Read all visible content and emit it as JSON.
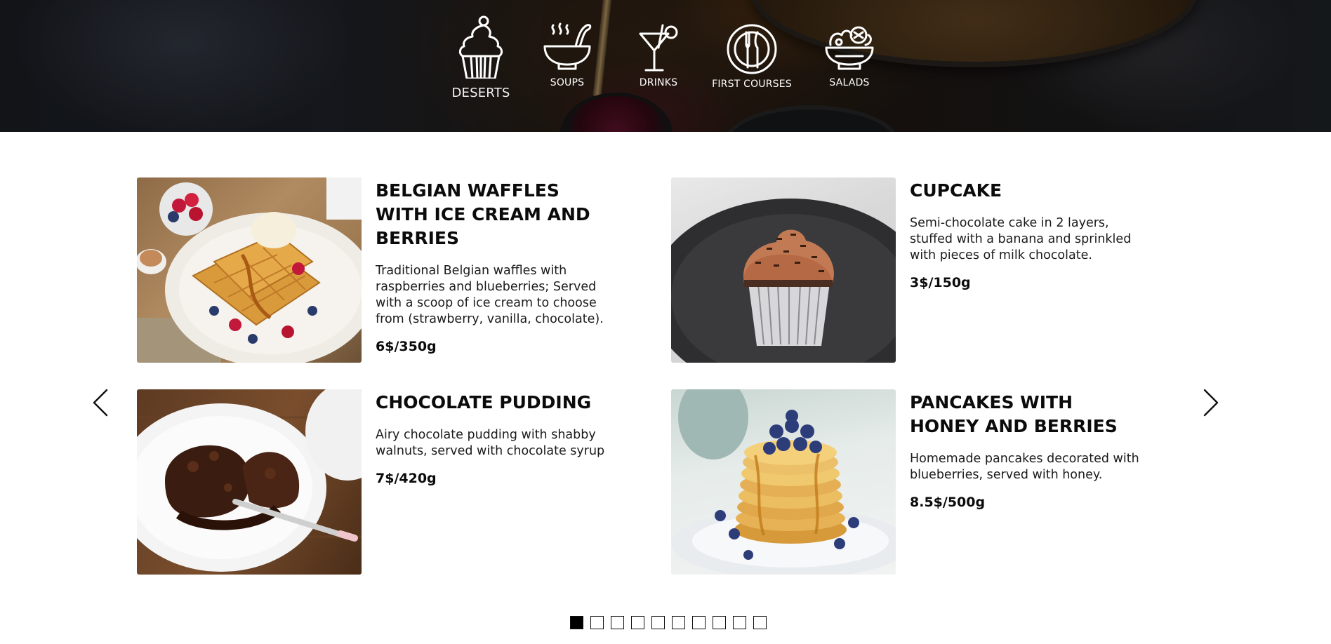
{
  "categories": [
    {
      "label": "DESERTS",
      "icon": "cupcake-icon",
      "active": true
    },
    {
      "label": "SOUPS",
      "icon": "soup-bowl-icon",
      "active": false
    },
    {
      "label": "DRINKS",
      "icon": "cocktail-glass-icon",
      "active": false
    },
    {
      "label": "FIRST COURSES",
      "icon": "plate-cutlery-icon",
      "active": false
    },
    {
      "label": "SALADS",
      "icon": "salad-bowl-icon",
      "active": false
    }
  ],
  "products": [
    {
      "title": "BELGIAN WAFFLES WITH ICE CREAM AND BERRIES",
      "description": "Traditional Belgian waffles with raspberries and blueberries; Served with a scoop of ice cream to choose from (strawberry, vanilla, chocolate).",
      "price": "6$/350g"
    },
    {
      "title": "CUPCAKE",
      "description": "Semi-chocolate cake in 2 layers, stuffed with a banana and sprinkled with pieces of milk chocolate.",
      "price": "3$/150g"
    },
    {
      "title": "CHOCOLATE PUDDING",
      "description": "Airy chocolate pudding with shabby walnuts, served with chocolate syrup",
      "price": "7$/420g"
    },
    {
      "title": "PANCAKES WITH HONEY AND BERRIES",
      "description": "Homemade pancakes decorated with blueberries, served with honey.",
      "price": "8.5$/500g"
    }
  ],
  "carousel": {
    "prev_icon": "chevron-left-icon",
    "next_icon": "chevron-right-icon",
    "pages_total": 10,
    "active_page": 1
  },
  "colors": {
    "text": "#0b0b0b",
    "nav_text": "#ffffff",
    "active_dot": "#000000"
  }
}
